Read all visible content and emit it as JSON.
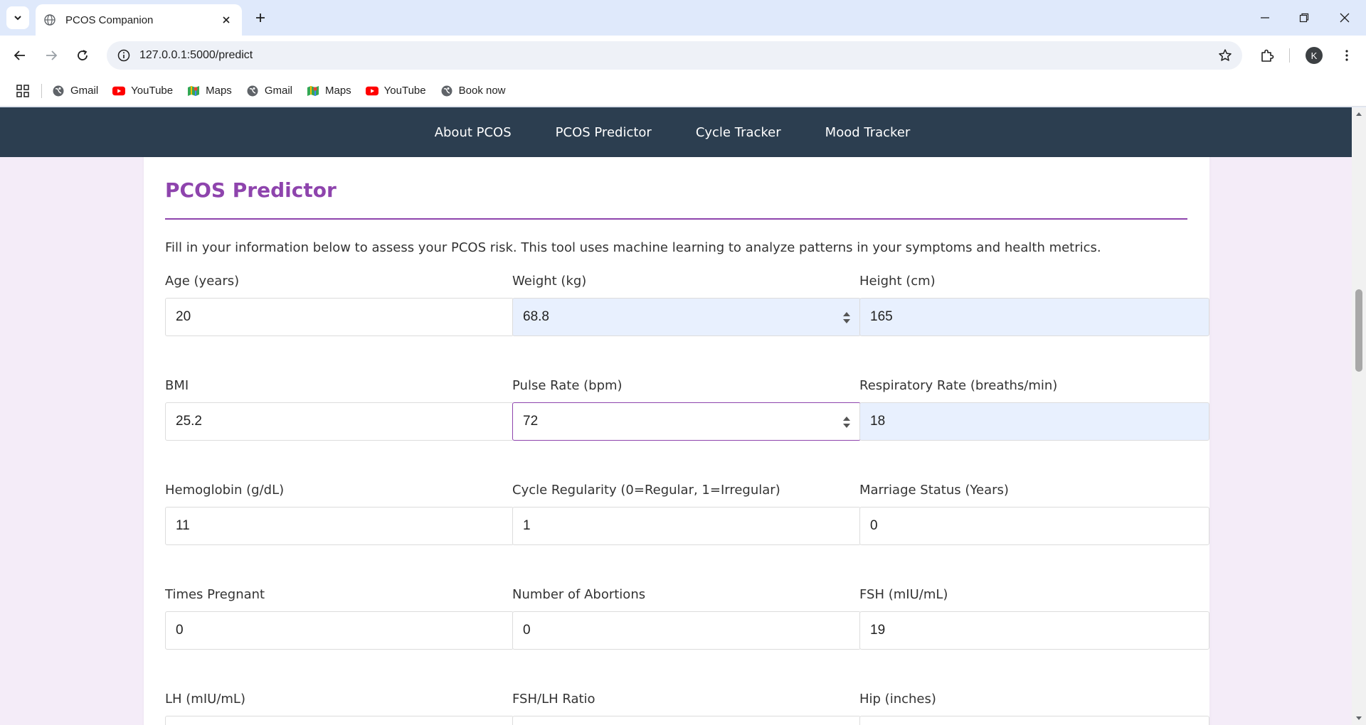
{
  "browser": {
    "tab_title": "PCOS Companion",
    "url": "127.0.0.1:5000/predict",
    "profile_initial": "K",
    "bookmarks": [
      {
        "label": "Gmail",
        "icon": "globe-icon"
      },
      {
        "label": "YouTube",
        "icon": "youtube-icon"
      },
      {
        "label": "Maps",
        "icon": "maps-icon"
      },
      {
        "label": "Gmail",
        "icon": "globe-icon"
      },
      {
        "label": "Maps",
        "icon": "maps-icon"
      },
      {
        "label": "YouTube",
        "icon": "youtube-icon"
      },
      {
        "label": "Book now",
        "icon": "globe-icon"
      }
    ]
  },
  "site": {
    "nav": [
      "About PCOS",
      "PCOS Predictor",
      "Cycle Tracker",
      "Mood Tracker"
    ],
    "colors": {
      "nav_bg": "#2c3e50",
      "accent": "#8e44ad",
      "page_bg": "#f4ecf8"
    }
  },
  "predictor": {
    "title": "PCOS Predictor",
    "intro": "Fill in your information below to assess your PCOS risk. This tool uses machine learning to analyze patterns in your symptoms and health metrics.",
    "fields": [
      {
        "label": "Age (years)",
        "value": "20"
      },
      {
        "label": "Weight (kg)",
        "value": "68.8"
      },
      {
        "label": "Height (cm)",
        "value": "165"
      },
      {
        "label": "BMI",
        "value": "25.2"
      },
      {
        "label": "Pulse Rate (bpm)",
        "value": "72"
      },
      {
        "label": "Respiratory Rate (breaths/min)",
        "value": "18"
      },
      {
        "label": "Hemoglobin (g/dL)",
        "value": "11"
      },
      {
        "label": "Cycle Regularity (0=Regular, 1=Irregular)",
        "value": "1"
      },
      {
        "label": "Marriage Status (Years)",
        "value": "0"
      },
      {
        "label": "Times Pregnant",
        "value": "0"
      },
      {
        "label": "Number of Abortions",
        "value": "0"
      },
      {
        "label": "FSH (mIU/mL)",
        "value": "19"
      },
      {
        "label": "LH (mIU/mL)",
        "value": ""
      },
      {
        "label": "FSH/LH Ratio",
        "value": ""
      },
      {
        "label": "Hip (inches)",
        "value": ""
      }
    ]
  }
}
